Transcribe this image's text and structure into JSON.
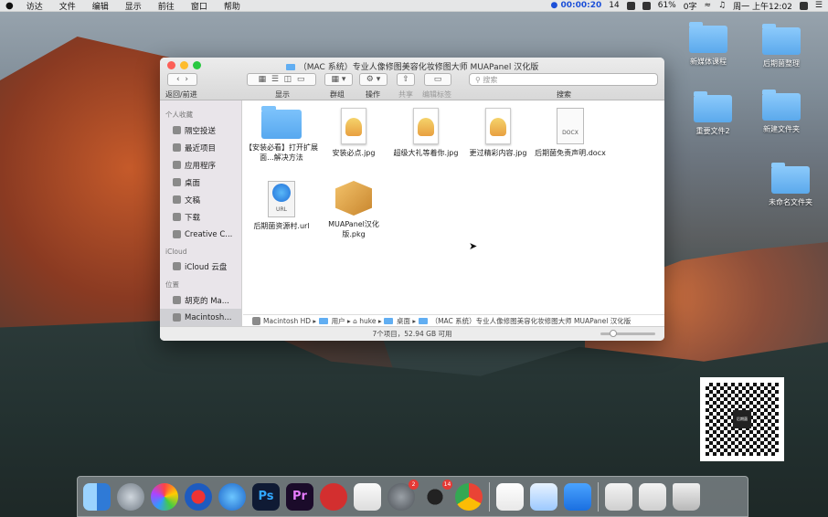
{
  "menubar": {
    "apple": "",
    "items": [
      "访达",
      "文件",
      "编辑",
      "显示",
      "前往",
      "窗口",
      "帮助"
    ],
    "recording_time": "00:00:20",
    "notifications_count": "14",
    "battery": "61%",
    "input_method": "0字",
    "clock": "周一 上午12:02"
  },
  "window": {
    "title": "（MAC 系统）专业人像修图美容化妆修图大师 MUAPanel 汉化版",
    "toolbar": {
      "back_forward_label": "返回/前进",
      "view_label": "显示",
      "group_label": "群组",
      "action_label": "操作",
      "share_label": "共享",
      "tags_label": "编辑标签",
      "search_label": "搜索",
      "search_placeholder": "搜索"
    },
    "sidebar": {
      "favorites_header": "个人收藏",
      "favorites": [
        "隔空投送",
        "最近项目",
        "应用程序",
        "桌面",
        "文稿",
        "下载",
        "Creative C..."
      ],
      "icloud_header": "iCloud",
      "icloud": [
        "iCloud 云盘"
      ],
      "locations_header": "位置",
      "locations": [
        "胡克的 Ma...",
        "Macintosh..."
      ]
    },
    "files": [
      {
        "name": "【安装必看】打开扩展面...解决方法",
        "kind": "folder"
      },
      {
        "name": "安装必点.jpg",
        "kind": "image"
      },
      {
        "name": "超级大礼等着你.jpg",
        "kind": "image"
      },
      {
        "name": "更过精彩内容.jpg",
        "kind": "image"
      },
      {
        "name": "后期菌免责声明.docx",
        "kind": "docx",
        "badge": "DOCX"
      },
      {
        "name": "后期菌资源村.url",
        "kind": "url",
        "badge": "URL"
      },
      {
        "name": "MUAPanel汉化版.pkg",
        "kind": "pkg"
      }
    ],
    "path": [
      "Macintosh HD",
      "用户",
      "huke",
      "桌面",
      "（MAC 系统）专业人像修图美容化妆修图大师 MUAPanel 汉化版"
    ],
    "status": "7个项目，52.94 GB 可用"
  },
  "desktop": {
    "icons": [
      "新媒体课程",
      "后期菌整理",
      "重要文件2",
      "新建文件夹",
      "未命名文件夹"
    ],
    "qr_label": "后期菌"
  },
  "dock": {
    "apps": [
      "Finder",
      "Launchpad",
      "Photos",
      "Music",
      "Safari",
      "Photoshop",
      "Premiere",
      "NetEase Music",
      "FaceTime",
      "System Preferences",
      "QQ",
      "Chrome",
      "Java",
      "Baidu Netdisk",
      "Zoom",
      "Documents",
      "Downloads",
      "Trash"
    ],
    "ps": "Ps",
    "pr": "Pr",
    "prefs_badge": "2",
    "qq_badge": "14"
  }
}
